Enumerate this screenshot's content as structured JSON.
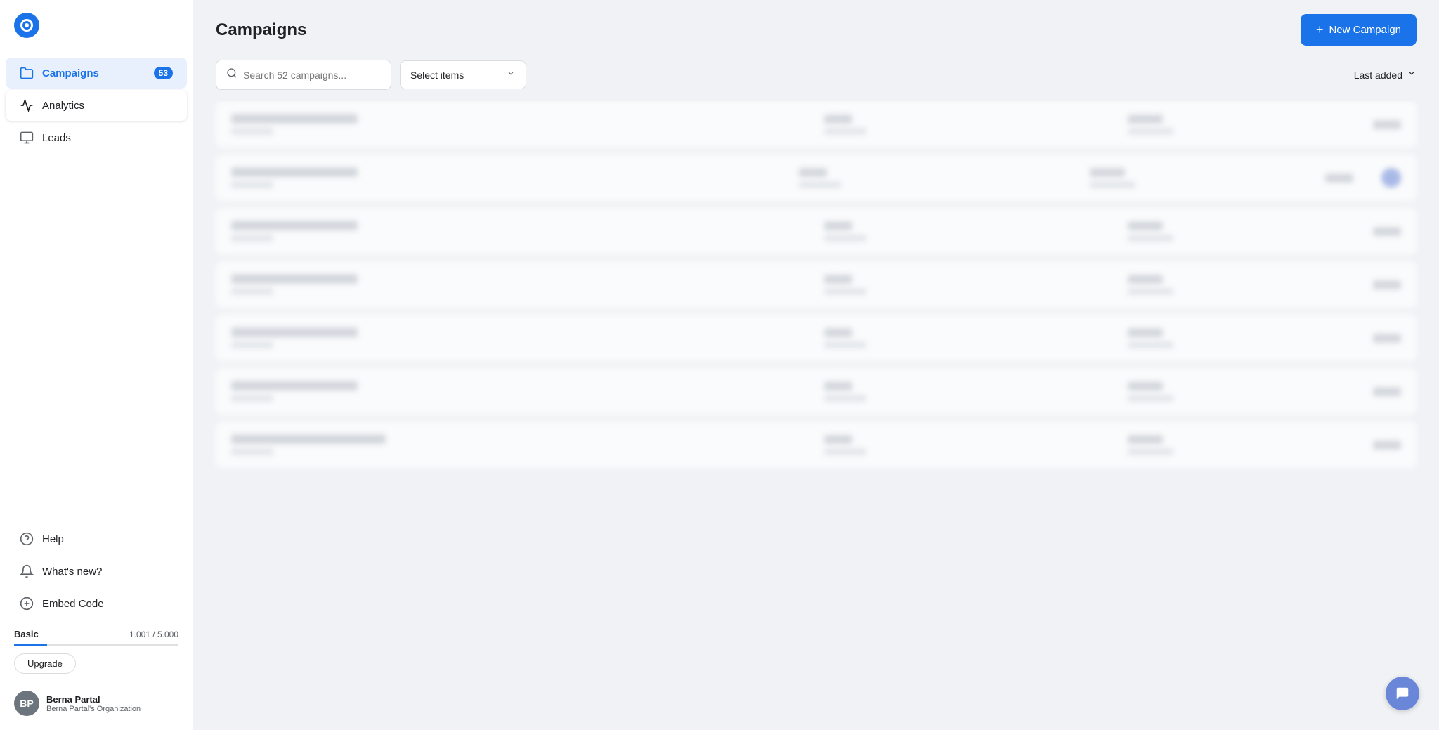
{
  "sidebar": {
    "nav_items": [
      {
        "id": "campaigns",
        "label": "Campaigns",
        "badge": "53",
        "active": true
      },
      {
        "id": "analytics",
        "label": "Analytics",
        "active_highlight": true
      },
      {
        "id": "leads",
        "label": "Leads"
      }
    ],
    "bottom_items": [
      {
        "id": "help",
        "label": "Help"
      },
      {
        "id": "whats-new",
        "label": "What's new?"
      },
      {
        "id": "embed-code",
        "label": "Embed Code"
      }
    ],
    "plan": {
      "name": "Basic",
      "usage": "1.001 / 5.000",
      "progress_pct": 20,
      "upgrade_label": "Upgrade"
    },
    "user": {
      "name": "Berna Partal",
      "org": "Berna Partal's Organization",
      "initials": "BP"
    }
  },
  "header": {
    "title": "Campaigns",
    "new_campaign_label": "New Campaign"
  },
  "toolbar": {
    "search_placeholder": "Search 52 campaigns...",
    "select_items_label": "Select items",
    "sort_label": "Last added"
  },
  "campaigns": {
    "rows": [
      {
        "id": 1,
        "has_dot": false
      },
      {
        "id": 2,
        "has_dot": true
      },
      {
        "id": 3,
        "has_dot": false
      },
      {
        "id": 4,
        "has_dot": false
      },
      {
        "id": 5,
        "has_dot": false
      },
      {
        "id": 6,
        "has_dot": false
      },
      {
        "id": 7,
        "has_dot": false
      }
    ]
  }
}
